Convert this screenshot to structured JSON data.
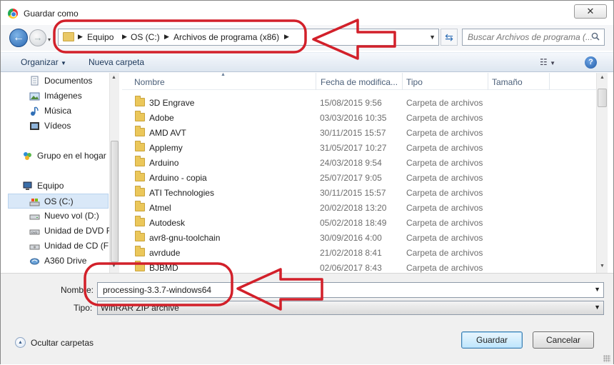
{
  "window": {
    "title": "Guardar como",
    "close_glyph": "✕"
  },
  "navbar": {
    "breadcrumb": [
      "Equipo",
      "OS (C:)",
      "Archivos de programa (x86)"
    ],
    "search_placeholder": "Buscar Archivos de programa (..."
  },
  "toolbar": {
    "organize_label": "Organizar",
    "new_folder_label": "Nueva carpeta",
    "help_glyph": "?"
  },
  "nav_pane": {
    "items": [
      {
        "label": "Documentos",
        "icon": "documents-icon"
      },
      {
        "label": "Imágenes",
        "icon": "pictures-icon"
      },
      {
        "label": "Música",
        "icon": "music-icon"
      },
      {
        "label": "Vídeos",
        "icon": "videos-icon"
      },
      {
        "label": "Grupo en el hogar",
        "icon": "homegroup-icon"
      },
      {
        "label": "Equipo",
        "icon": "computer-icon"
      },
      {
        "label": "OS (C:)",
        "icon": "drive-c-icon",
        "selected": true
      },
      {
        "label": "Nuevo vol (D:)",
        "icon": "drive-d-icon"
      },
      {
        "label": "Unidad de DVD R",
        "icon": "dvd-drive-icon"
      },
      {
        "label": "Unidad de CD (F:",
        "icon": "cd-drive-icon"
      },
      {
        "label": "A360 Drive",
        "icon": "a360-drive-icon"
      }
    ]
  },
  "file_list": {
    "columns": [
      "Nombre",
      "Fecha de modifica...",
      "Tipo",
      "Tamaño"
    ],
    "rows": [
      {
        "name": "3D Engrave",
        "date": "15/08/2015 9:56",
        "type": "Carpeta de archivos"
      },
      {
        "name": "Adobe",
        "date": "03/03/2016 10:35",
        "type": "Carpeta de archivos"
      },
      {
        "name": "AMD AVT",
        "date": "30/11/2015 15:57",
        "type": "Carpeta de archivos"
      },
      {
        "name": "Applemy",
        "date": "31/05/2017 10:27",
        "type": "Carpeta de archivos"
      },
      {
        "name": "Arduino",
        "date": "24/03/2018 9:54",
        "type": "Carpeta de archivos"
      },
      {
        "name": "Arduino - copia",
        "date": "25/07/2017 9:05",
        "type": "Carpeta de archivos"
      },
      {
        "name": "ATI Technologies",
        "date": "30/11/2015 15:57",
        "type": "Carpeta de archivos"
      },
      {
        "name": "Atmel",
        "date": "20/02/2018 13:20",
        "type": "Carpeta de archivos"
      },
      {
        "name": "Autodesk",
        "date": "05/02/2018 18:49",
        "type": "Carpeta de archivos"
      },
      {
        "name": "avr8-gnu-toolchain",
        "date": "30/09/2016 4:00",
        "type": "Carpeta de archivos"
      },
      {
        "name": "avrdude",
        "date": "21/02/2018 8:41",
        "type": "Carpeta de archivos"
      },
      {
        "name": "BJBMD",
        "date": "02/06/2017 8:43",
        "type": "Carpeta de archivos"
      }
    ]
  },
  "bottom": {
    "name_label": "Nombre:",
    "name_value": "processing-3.3.7-windows64",
    "type_label": "Tipo:",
    "type_value": "WinRAR ZIP archive",
    "hide_folders_label": "Ocultar carpetas",
    "save_label": "Guardar",
    "cancel_label": "Cancelar"
  },
  "colors": {
    "annotation": "#d2202a",
    "selection": "#d9e8f8",
    "toolbar_text": "#1e395b"
  }
}
